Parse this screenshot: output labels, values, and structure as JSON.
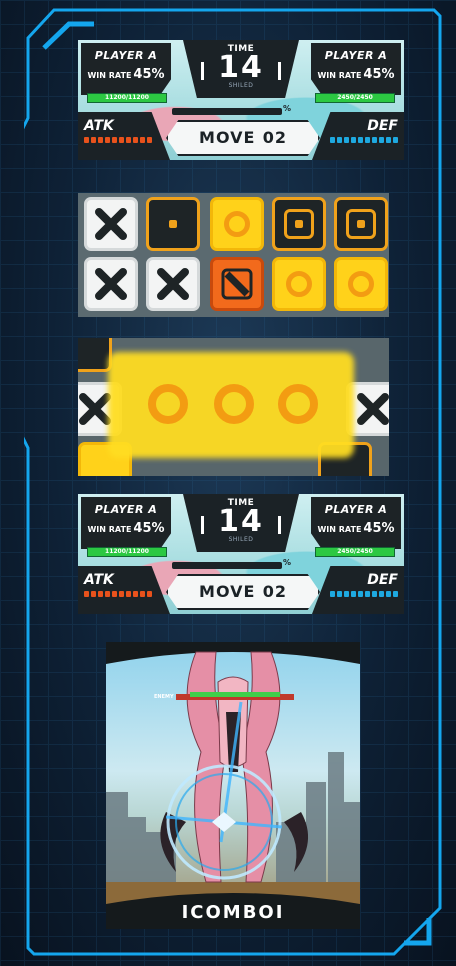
{
  "hud": {
    "player_left": "PLAYER A",
    "player_right": "PLAYER A",
    "win_rate_label": "WIN RATE",
    "win_rate_left": "45%",
    "win_rate_right": "45%",
    "time_label": "TIME",
    "time_value": "14",
    "shield_label": "SHILED",
    "hp_left": "11200/11200",
    "hp_right": "2450/2450",
    "atk_label": "ATK",
    "def_label": "DEF",
    "move_label": "MOVE",
    "move_value": "02",
    "percent_sign": "%",
    "atk_color": "#e8521c",
    "def_color": "#1ea9e0"
  },
  "board": {
    "rows": [
      [
        "x-white",
        "dot-dark",
        "target-yellow",
        "dot-dark",
        "dot-dark"
      ],
      [
        "x-white",
        "x-white",
        "slash-orange",
        "target-yellow",
        "target-yellow"
      ]
    ]
  },
  "scene": {
    "combo_text": "ICOMBOI",
    "enemy_label": "ENEMY"
  },
  "colors": {
    "frame_accent": "#14a6ee",
    "tile_yellow": "#ffd21a",
    "tile_orange": "#f26a1c"
  }
}
